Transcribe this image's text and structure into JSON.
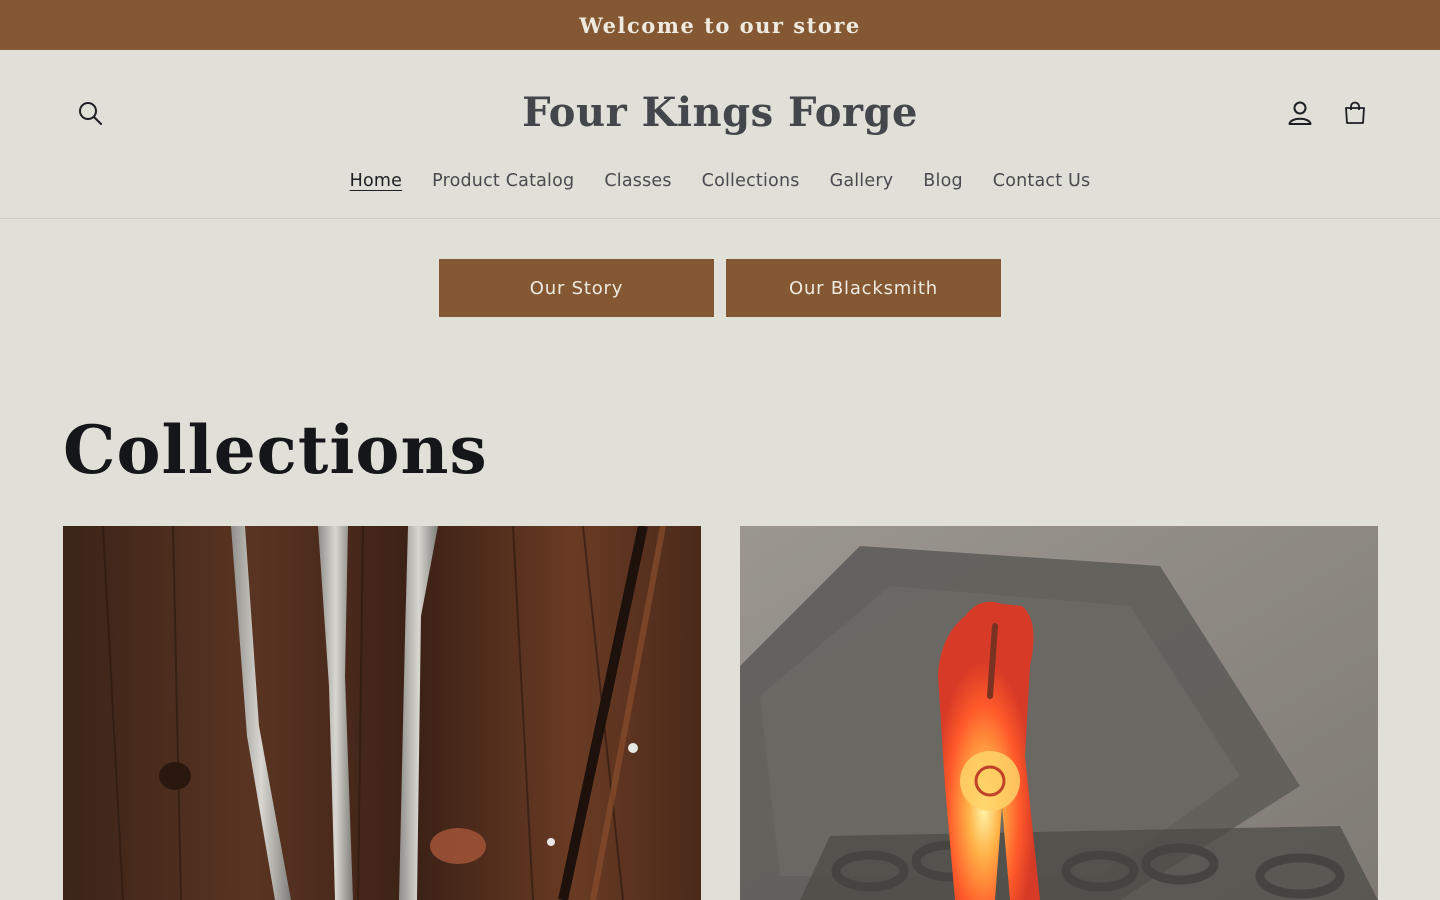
{
  "announcement": {
    "text": "Welcome to our store"
  },
  "header": {
    "store_name": "Four Kings Forge",
    "icons": {
      "search": "search-icon",
      "account": "account-icon",
      "cart": "cart-icon"
    }
  },
  "nav": {
    "items": [
      {
        "label": "Home",
        "active": true
      },
      {
        "label": "Product Catalog"
      },
      {
        "label": "Classes"
      },
      {
        "label": "Collections"
      },
      {
        "label": "Gallery"
      },
      {
        "label": "Blog"
      },
      {
        "label": "Contact Us"
      }
    ]
  },
  "buttons": {
    "story": "Our Story",
    "blacksmith": "Our Blacksmith"
  },
  "collections": {
    "title": "Collections",
    "cards": [
      {
        "image": "forged-steel-tools-on-wood"
      },
      {
        "image": "glowing-hot-tongs-at-forge"
      }
    ]
  },
  "colors": {
    "brand": "#845832",
    "background": "#e0dfd8",
    "text": "#1d1f23"
  }
}
